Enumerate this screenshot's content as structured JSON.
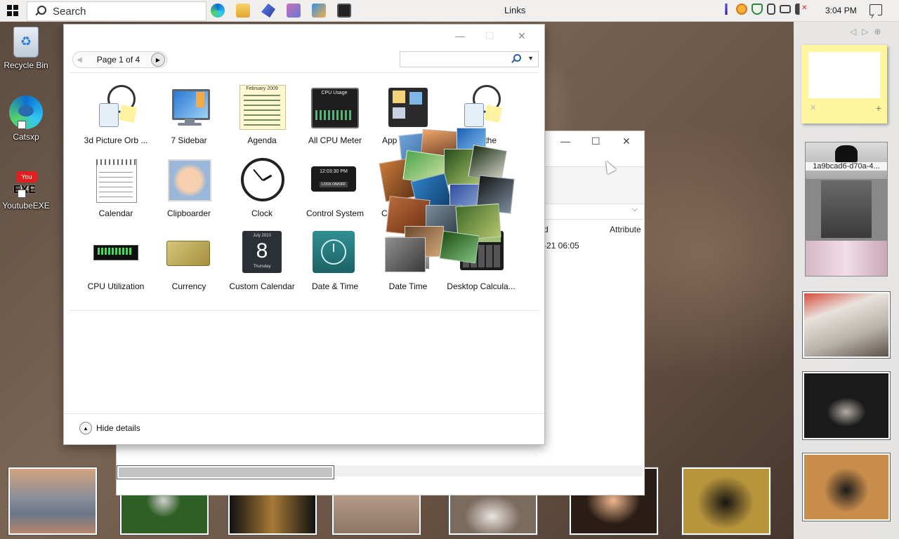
{
  "taskbar": {
    "search_label": "Search",
    "window_title": "Links",
    "clock": "3:04 PM"
  },
  "desktop_icons": [
    {
      "label": "Recycle Bin",
      "icon": "recycle-bin-icon"
    },
    {
      "label": "Catsxp",
      "icon": "catsxp-browser-icon"
    },
    {
      "label": "YoutubeEXE",
      "icon": "youtube-exe-icon"
    }
  ],
  "gallery": {
    "pager_text": "Page 1 of 4",
    "search_placeholder": "",
    "hide_details": "Hide details",
    "gadgets": [
      {
        "label": "3d Picture Orb ...",
        "icon": "clock-calculator-icon"
      },
      {
        "label": "7 Sidebar",
        "icon": "monitor-icon"
      },
      {
        "label": "Agenda",
        "icon": "calendar-grid-icon"
      },
      {
        "label": "All CPU Meter",
        "icon": "cpu-meter-icon"
      },
      {
        "label": "App L",
        "icon": "app-launcher-icon"
      },
      {
        "label": "athe",
        "icon": "clock-calculator-icon"
      },
      {
        "label": "Calendar",
        "icon": "calendar-icon"
      },
      {
        "label": "Clipboarder",
        "icon": "baby-photo-icon"
      },
      {
        "label": "Clock",
        "icon": "clock-icon"
      },
      {
        "label": "Control System",
        "icon": "control-system-icon"
      },
      {
        "label": "C",
        "icon": "photo-icon"
      },
      {
        "label": "CPU Utilization",
        "icon": "cpu-utilization-icon"
      },
      {
        "label": "Currency",
        "icon": "currency-icon"
      },
      {
        "label": "Custom Calendar",
        "icon": "custom-calendar-icon"
      },
      {
        "label": "Date & Time",
        "icon": "date-time-icon"
      },
      {
        "label": "Date Time",
        "icon": "date-time-photo-icon"
      },
      {
        "label": "Desktop Calcula...",
        "icon": "desktop-calculator-icon"
      }
    ],
    "agenda_art": {
      "month": "February 2009"
    },
    "custom_calendar_art": {
      "month": "July 2010",
      "day": "8",
      "weekday": "Thursday"
    },
    "control_system_art": {
      "time": "12:03:30 PM",
      "button": "LOCK ON/OFF"
    },
    "cpu_meter_art": {
      "title": "CPU Usage"
    }
  },
  "background_window": {
    "column_header_1": "d",
    "column_header_2": "Attribute",
    "cell_value": "-21 06:05"
  },
  "right_sidebar": {
    "slideshow_caption": "1a9bcad6-d70a-4..."
  },
  "colors": {
    "taskbar": "#f1efed",
    "sticky_note": "#fff59e",
    "accent_blue": "#2c5fa8"
  }
}
